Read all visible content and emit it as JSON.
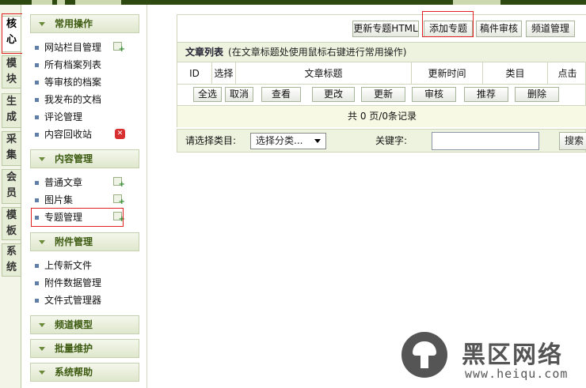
{
  "vertical_tabs": [
    {
      "label": "核心",
      "active": true
    },
    {
      "label": "模块",
      "active": false
    },
    {
      "label": "生成",
      "active": false
    },
    {
      "label": "采集",
      "active": false
    },
    {
      "label": "会员",
      "active": false
    },
    {
      "label": "模板",
      "active": false
    },
    {
      "label": "系统",
      "active": false
    }
  ],
  "sidebar": {
    "sections": [
      {
        "title": "常用操作",
        "items": [
          "网站栏目管理",
          "所有档案列表",
          "等审核的档案",
          "我发布的文档",
          "评论管理",
          "内容回收站"
        ]
      },
      {
        "title": "内容管理",
        "items": [
          "普通文章",
          "图片集",
          "专题管理"
        ]
      },
      {
        "title": "附件管理",
        "items": [
          "上传新文件",
          "附件数据管理",
          "文件式管理器"
        ]
      },
      {
        "title": "频道模型",
        "items": []
      },
      {
        "title": "批量维护",
        "items": []
      },
      {
        "title": "系统帮助",
        "items": []
      }
    ]
  },
  "toolbar": {
    "buttons": [
      "更新专题HTML",
      "添加专题",
      "稿件审核",
      "频道管理"
    ]
  },
  "list": {
    "title": "文章列表",
    "hint": "(在文章标题处使用鼠标右键进行常用操作)",
    "columns": [
      "ID",
      "选择",
      "文章标题",
      "更新时间",
      "类目",
      "点击"
    ],
    "actions": [
      "全选",
      "取消",
      "查看",
      "更改",
      "更新",
      "审核",
      "推荐",
      "删除"
    ],
    "pagination": "共 0 页/0条记录"
  },
  "filter": {
    "category_label": "请选择类目:",
    "category_value": "选择分类...",
    "keyword_label": "关键字:",
    "search_label": "搜索"
  },
  "watermark": {
    "name": "黑区网络",
    "url": "www.heiqu.com"
  },
  "colors": {
    "highlight_box": "#e02020",
    "section_header_text": "#3c5a10",
    "list_title_bg": "#eef3df"
  }
}
